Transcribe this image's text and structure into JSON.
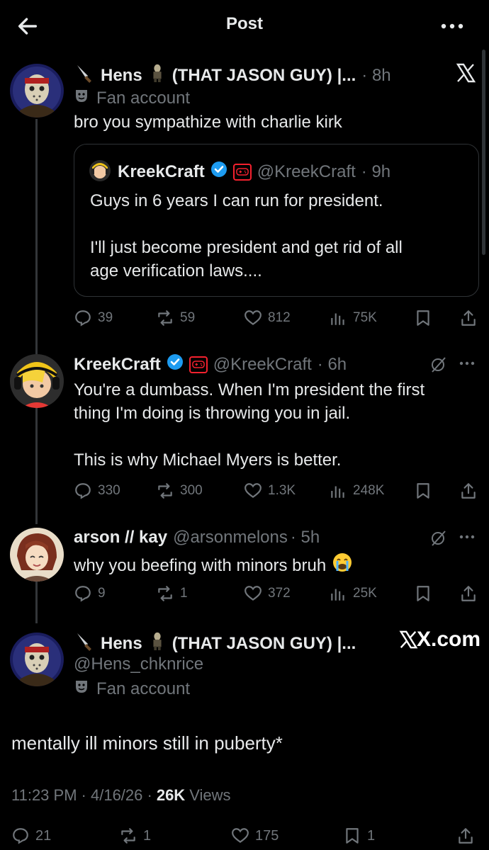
{
  "header": {
    "title": "Post"
  },
  "tweet1": {
    "name": "Hens",
    "name_suffix": "(THAT JASON GUY) |...",
    "time": "· 8h",
    "badge": "Fan account",
    "text": "bro you sympathize with charlie kirk",
    "quote": {
      "name": "KreekCraft",
      "handle": "@KreekCraft",
      "time": "· 9h",
      "line1": "Guys in 6 years I can run for president.",
      "line2": "I'll just become president and get rid of all",
      "line3": "age verification laws...."
    },
    "stats": {
      "replies": "39",
      "reposts": "59",
      "likes": "812",
      "views": "75K"
    }
  },
  "tweet2": {
    "name": "KreekCraft",
    "handle": "@KreekCraft",
    "time": "· 6h",
    "line1": "You're a dumbass. When I'm president the first",
    "line2": "thing I'm doing is throwing you in jail.",
    "line3": "This is why Michael Myers is better.",
    "stats": {
      "replies": "330",
      "reposts": "300",
      "likes": "1.3K",
      "views": "248K"
    }
  },
  "tweet3": {
    "name": "arson // kay",
    "handle": "@arsonmelons",
    "time": "· 5h",
    "text": "why you beefing with minors bruh",
    "stats": {
      "replies": "9",
      "reposts": "1",
      "likes": "372",
      "views": "25K"
    }
  },
  "main": {
    "name": "Hens",
    "name_suffix": "(THAT JASON GUY) |...",
    "handle": "@Hens_chknrice",
    "badge": "Fan account",
    "text": "mentally ill minors still in puberty*",
    "time": "11:23 PM",
    "date": "· 4/16/26 ·",
    "views_count": "26K",
    "views_label": "Views",
    "stats": {
      "replies": "21",
      "reposts": "1",
      "likes": "175",
      "bookmarks": "1"
    }
  },
  "watermark": {
    "label": "X.com"
  },
  "colors": {
    "accent": "#1d9bf0",
    "muted": "#71767b",
    "background": "#000000",
    "text": "#e7e9ea"
  }
}
